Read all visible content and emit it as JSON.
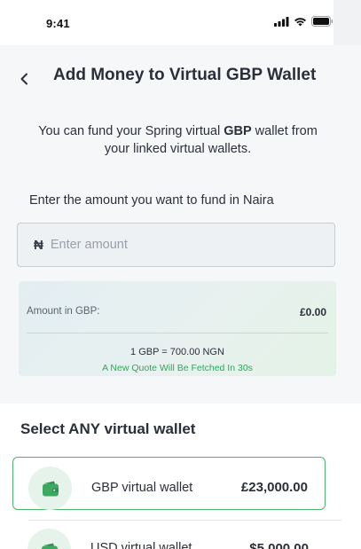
{
  "status_bar": {
    "time": "9:41",
    "icons": [
      "signal-icon",
      "wifi-icon",
      "battery-icon"
    ]
  },
  "header": {
    "back_icon": "chevron-left-icon",
    "title": "Add Money to Virtual GBP Wallet"
  },
  "description": {
    "before": "You can fund your Spring virtual ",
    "bold": "GBP",
    "after": " wallet from your linked virtual wallets."
  },
  "amount": {
    "label": "Enter the amount you want to fund in Naira",
    "currency_symbol": "₦",
    "placeholder": "Enter amount",
    "value": ""
  },
  "quote": {
    "label": "Amount in GBP:",
    "value": "£0.00",
    "rate": "1 GBP = 700.00 NGN",
    "note": "A New Quote Will Be Fetched In 30s"
  },
  "wallets": {
    "title": "Select ANY virtual wallet",
    "items": [
      {
        "name": "GBP virtual wallet",
        "balance": "£23,000.00",
        "icon": "wallet-icon",
        "selected": true
      },
      {
        "name": "USD virtual wallet",
        "balance": "$5,000.00",
        "icon": "wallet-icon",
        "selected": false
      }
    ]
  },
  "colors": {
    "accent_green": "#4cb46c",
    "note_green": "#2aa85a",
    "icon_green": "#3ea862"
  }
}
